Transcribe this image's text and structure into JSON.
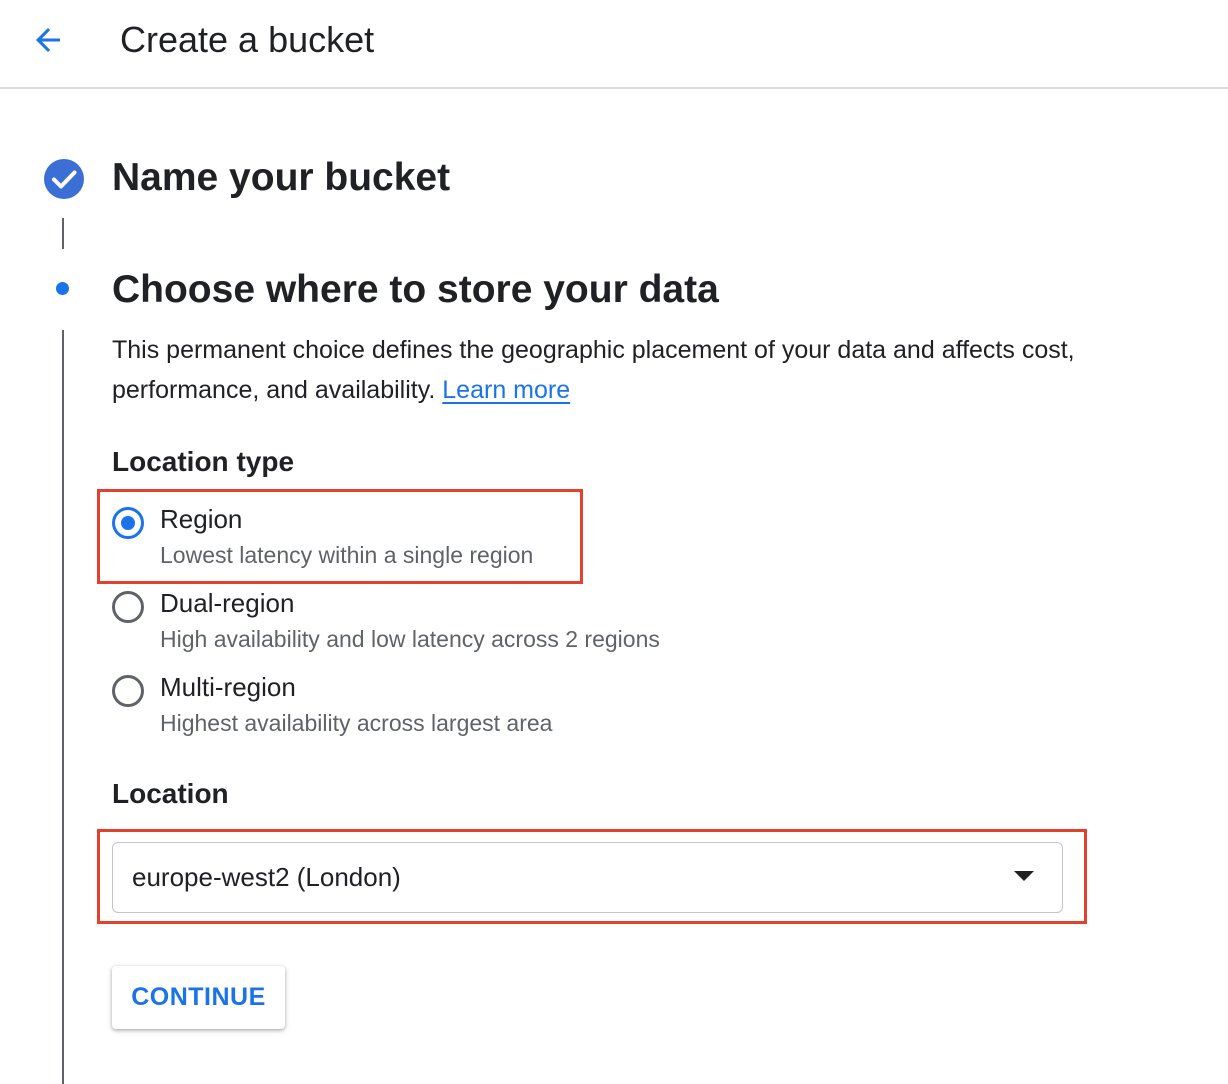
{
  "header": {
    "title": "Create a bucket",
    "back_icon": "arrow-back-icon"
  },
  "steps": [
    {
      "title": "Name your bucket",
      "status": "complete",
      "icon": "check-circle-icon"
    },
    {
      "title": "Choose where to store your data",
      "status": "active"
    }
  ],
  "description": {
    "text": "This permanent choice defines the geographic placement of your data and affects cost, performance, and availability.",
    "link": "Learn more"
  },
  "location_type": {
    "label": "Location type",
    "options": [
      {
        "label": "Region",
        "desc": "Lowest latency within a single region",
        "checked": true
      },
      {
        "label": "Dual-region",
        "desc": "High availability and low latency across 2 regions",
        "checked": false
      },
      {
        "label": "Multi-region",
        "desc": "Highest availability across largest area",
        "checked": false
      }
    ]
  },
  "location": {
    "label": "Location",
    "value": "europe-west2 (London)"
  },
  "continue_label": "CONTINUE",
  "colors": {
    "accent": "#1a73e8",
    "highlight": "#e1412d",
    "text": "#202124",
    "secondary_text": "#5f6368"
  }
}
